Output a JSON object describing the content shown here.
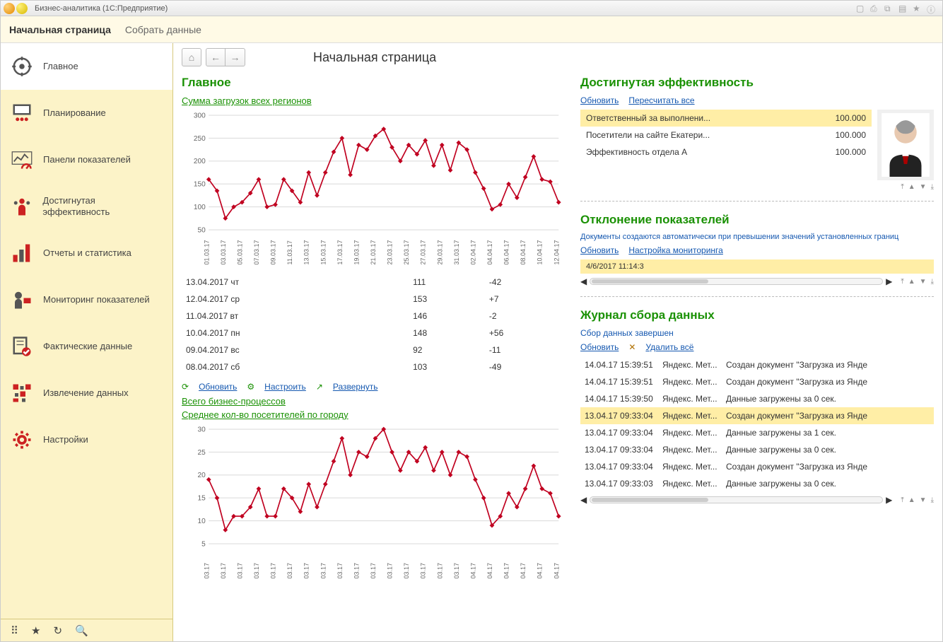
{
  "window_title": "Бизнес-аналитика  (1С:Предприятие)",
  "tabs": {
    "active": "Начальная страница",
    "other": "Собрать данные"
  },
  "sidebar": {
    "items": [
      {
        "label": "Главное"
      },
      {
        "label": "Планирование"
      },
      {
        "label": "Панели показателей"
      },
      {
        "label": "Достигнутая эффективность"
      },
      {
        "label": "Отчеты и статистика"
      },
      {
        "label": "Мониторинг показателей"
      },
      {
        "label": "Фактические данные"
      },
      {
        "label": "Извлечение данных"
      },
      {
        "label": "Настройки"
      }
    ]
  },
  "page_title": "Начальная страница",
  "main": {
    "heading": "Главное",
    "chart1_link": "Сумма загрузок всех регионов",
    "chart2_link": "Среднее кол-во посетителей по городу",
    "bp_link": "Всего бизнес-процессов",
    "actions": {
      "refresh": "Обновить",
      "configure": "Настроить",
      "expand": "Развернуть"
    },
    "mini_table": [
      {
        "date": "13.04.2017 чт",
        "v": "111",
        "d": "-42"
      },
      {
        "date": "12.04.2017 ср",
        "v": "153",
        "d": "+7"
      },
      {
        "date": "11.04.2017 вт",
        "v": "146",
        "d": "-2"
      },
      {
        "date": "10.04.2017 пн",
        "v": "148",
        "d": "+56"
      },
      {
        "date": "09.04.2017 вс",
        "v": "92",
        "d": "-11"
      },
      {
        "date": "08.04.2017 сб",
        "v": "103",
        "d": "-49"
      }
    ]
  },
  "eff": {
    "heading": "Достигнутая эффективность",
    "links": {
      "refresh": "Обновить",
      "recalc": "Пересчитать все"
    },
    "rows": [
      {
        "name": "Ответственный за выполнени...",
        "val": "100.000",
        "hl": true
      },
      {
        "name": "Посетители на сайте Екатери...",
        "val": "100.000"
      },
      {
        "name": "Эффективность отдела А",
        "val": "100.000"
      }
    ]
  },
  "dev": {
    "heading": "Отклонение показателей",
    "note": "Документы создаются автоматически при превышении значений установленных границ",
    "links": {
      "refresh": "Обновить",
      "setup": "Настройка мониторинга"
    },
    "row_date": "4/6/2017 11:14:3"
  },
  "log": {
    "heading": "Журнал сбора данных",
    "status": "Сбор данных завершен",
    "links": {
      "refresh": "Обновить",
      "delete": "Удалить всё"
    },
    "rows": [
      {
        "t": "14.04.17 15:39:51",
        "s": "Яндекс. Мет...",
        "m": "Создан документ \"Загрузка из Янде"
      },
      {
        "t": "14.04.17 15:39:51",
        "s": "Яндекс. Мет...",
        "m": "Создан документ \"Загрузка из Янде"
      },
      {
        "t": "14.04.17 15:39:50",
        "s": "Яндекс. Мет...",
        "m": "Данные загружены за 0 сек."
      },
      {
        "t": "13.04.17 09:33:04",
        "s": "Яндекс. Мет...",
        "m": "Создан документ \"Загрузка из Янде",
        "hl": true
      },
      {
        "t": "13.04.17 09:33:04",
        "s": "Яндекс. Мет...",
        "m": "Данные загружены за 1 сек."
      },
      {
        "t": "13.04.17 09:33:04",
        "s": "Яндекс. Мет...",
        "m": "Данные загружены за 0 сек."
      },
      {
        "t": "13.04.17 09:33:04",
        "s": "Яндекс. Мет...",
        "m": "Создан документ \"Загрузка из Янде"
      },
      {
        "t": "13.04.17 09:33:03",
        "s": "Яндекс. Мет...",
        "m": "Данные загружены за 0 сек."
      }
    ]
  },
  "chart_data": [
    {
      "type": "line",
      "title": "Сумма загрузок всех регионов",
      "ylim": [
        50,
        300
      ],
      "yticks": [
        50,
        100,
        150,
        200,
        250,
        300
      ],
      "categories": [
        "01.03.17",
        "03.03.17",
        "05.03.17",
        "07.03.17",
        "09.03.17",
        "11.03.17",
        "13.03.17",
        "15.03.17",
        "17.03.17",
        "19.03.17",
        "21.03.17",
        "23.03.17",
        "25.03.17",
        "27.03.17",
        "29.03.17",
        "31.03.17",
        "02.04.17",
        "04.04.17",
        "06.04.17",
        "08.04.17",
        "10.04.17",
        "12.04.17"
      ],
      "values": [
        160,
        135,
        75,
        100,
        110,
        130,
        160,
        100,
        105,
        160,
        135,
        110,
        175,
        125,
        175,
        220,
        250,
        170,
        235,
        225,
        255,
        270,
        230,
        200,
        235,
        215,
        245,
        190,
        235,
        180,
        240,
        225,
        175,
        140,
        95,
        105,
        150,
        120,
        165,
        210,
        160,
        155,
        110
      ]
    },
    {
      "type": "line",
      "title": "Среднее кол-во посетителей по городу",
      "ylim": [
        5,
        30
      ],
      "yticks": [
        5,
        10,
        15,
        20,
        25,
        30
      ],
      "categories": [
        "03.17",
        "03.17",
        "03.17",
        "03.17",
        "03.17",
        "03.17",
        "03.17",
        "03.17",
        "03.17",
        "03.17",
        "03.17",
        "03.17",
        "03.17",
        "03.17",
        "03.17",
        "03.17",
        "04.17",
        "04.17",
        "04.17",
        "04.17",
        "04.17",
        "04.17"
      ],
      "values": [
        19,
        15,
        8,
        11,
        11,
        13,
        17,
        11,
        11,
        17,
        15,
        12,
        18,
        13,
        18,
        23,
        28,
        20,
        25,
        24,
        28,
        30,
        25,
        21,
        25,
        23,
        26,
        21,
        25,
        20,
        25,
        24,
        19,
        15,
        9,
        11,
        16,
        13,
        17,
        22,
        17,
        16,
        11
      ]
    }
  ]
}
